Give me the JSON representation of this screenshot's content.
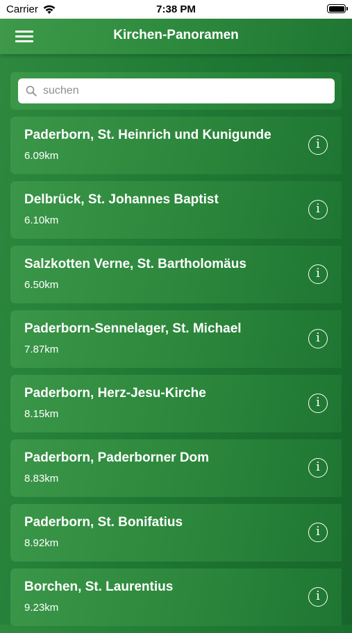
{
  "status_bar": {
    "carrier": "Carrier",
    "time": "7:38 PM",
    "wifi_icon": "wifi-icon",
    "battery_icon": "battery-icon"
  },
  "nav": {
    "title": "Kirchen-Panoramen",
    "menu_icon": "hamburger-menu-icon"
  },
  "search": {
    "placeholder": "suchen",
    "value": "",
    "icon": "search-icon"
  },
  "colors": {
    "primary_green": "#2d8a3d",
    "dark_green": "#17652b",
    "text_on_green": "#ffffff"
  },
  "churches": [
    {
      "name": "Paderborn, St. Heinrich und Kunigunde",
      "distance": "6.09km",
      "info_glyph": "i"
    },
    {
      "name": "Delbrück, St. Johannes Baptist",
      "distance": "6.10km",
      "info_glyph": "i"
    },
    {
      "name": "Salzkotten Verne, St. Bartholomäus",
      "distance": "6.50km",
      "info_glyph": "i"
    },
    {
      "name": "Paderborn-Sennelager, St. Michael",
      "distance": "7.87km",
      "info_glyph": "i"
    },
    {
      "name": "Paderborn, Herz-Jesu-Kirche",
      "distance": "8.15km",
      "info_glyph": "i"
    },
    {
      "name": "Paderborn, Paderborner Dom",
      "distance": "8.83km",
      "info_glyph": "i"
    },
    {
      "name": "Paderborn, St. Bonifatius",
      "distance": "8.92km",
      "info_glyph": "i"
    },
    {
      "name": "Borchen, St. Laurentius",
      "distance": "9.23km",
      "info_glyph": "i"
    }
  ]
}
